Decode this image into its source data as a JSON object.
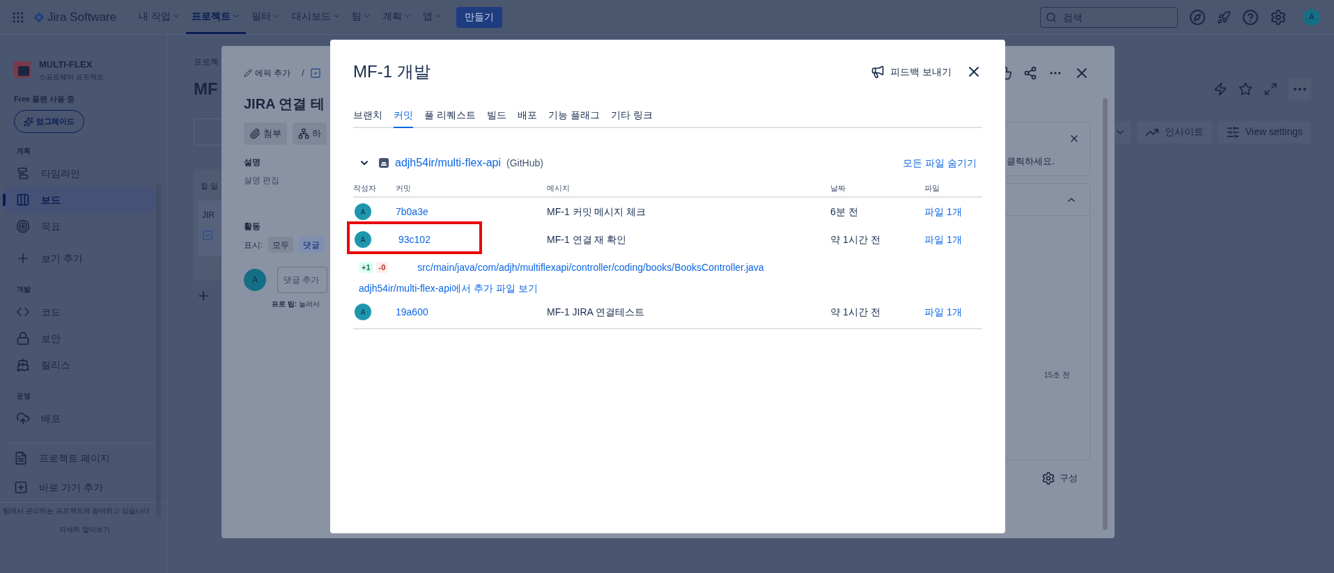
{
  "top_nav": {
    "product": "Jira Software",
    "menus": [
      {
        "label": "내 작업",
        "selected": false
      },
      {
        "label": "프로젝트",
        "selected": true
      },
      {
        "label": "필터",
        "selected": false
      },
      {
        "label": "대시보드",
        "selected": false
      },
      {
        "label": "팀",
        "selected": false
      },
      {
        "label": "계획",
        "selected": false
      },
      {
        "label": "앱",
        "selected": false
      }
    ],
    "create_button": "만들기",
    "search": {
      "placeholder": "검색"
    },
    "avatar": "A"
  },
  "sidebar": {
    "project_name": "MULTI-FLEX",
    "project_type": "소프트웨어 프로젝트",
    "plan": "Free 플랜 사용 중",
    "upgrade_button": "업그레이드",
    "sections": [
      {
        "heading": "계획",
        "items": [
          {
            "label": "타임라인",
            "selected": false
          },
          {
            "label": "보드",
            "selected": true
          },
          {
            "label": "목표",
            "selected": false
          },
          {
            "label": "보기 추가",
            "selected": false
          }
        ]
      },
      {
        "heading": "개발",
        "items": [
          {
            "label": "코드",
            "selected": false
          },
          {
            "label": "보안",
            "selected": false
          },
          {
            "label": "릴리스",
            "selected": false
          }
        ]
      },
      {
        "heading": "운영",
        "items": [
          {
            "label": "배포",
            "selected": false
          }
        ]
      }
    ],
    "links": [
      {
        "label": "프로젝트 페이지"
      },
      {
        "label": "바로 가기 추가"
      }
    ],
    "footer_note": "팀에서 관리하는 프로젝트에 참여하고 있습니다",
    "learn_more": "자세히 알아보기"
  },
  "board": {
    "breadcrumb": "프로젝",
    "title": "MF",
    "column": {
      "title": "할 일",
      "cards": [
        {
          "title": "JIR"
        }
      ]
    },
    "toolbar": [
      {
        "label": "인사이트"
      },
      {
        "label": "View settings"
      }
    ]
  },
  "issue": {
    "epic_link": "에픽 추가",
    "separator": "/",
    "title": "JIRA 연결 테",
    "actions": [
      {
        "label": "첨부"
      },
      {
        "label": "하"
      }
    ],
    "description_heading": "설명",
    "description_placeholder": "설명 편집",
    "activity_heading": "활동",
    "show_label": "표시:",
    "filters": [
      {
        "label": "모두",
        "selected": false
      },
      {
        "label": "댓글",
        "selected": true
      }
    ],
    "avatar": "A",
    "comment": {
      "placeholder": "댓글 추가"
    },
    "pro_tip": "**프로 팁:** 눌러서",
    "notice": "클릭하세요.",
    "panel_time": "15초 전",
    "configure_button": "구성"
  },
  "dialog": {
    "title": "MF-1 개발",
    "feedback_button": "피드백 보내기",
    "tabs": [
      {
        "label": "브랜치",
        "selected": false
      },
      {
        "label": "커밋",
        "selected": true
      },
      {
        "label": "풀 리퀘스트",
        "selected": false
      },
      {
        "label": "빌드",
        "selected": false
      },
      {
        "label": "배포",
        "selected": false
      },
      {
        "label": "기능 플래그",
        "selected": false
      },
      {
        "label": "기타 링크",
        "selected": false
      }
    ],
    "repository": {
      "name": "adjh54ir/multi-flex-api",
      "host": "(GitHub)",
      "expanded": true,
      "toggle_files": "모든 파일 숨기기"
    },
    "columns": [
      "작성자",
      "커밋",
      "메시지",
      "날짜",
      "파일"
    ],
    "commits": [
      {
        "author": "A",
        "hash": "7b0a3e",
        "message": "MF-1 커밋 메시지 체크",
        "date": "6분 전",
        "files": "파일 1개",
        "highlighted": false
      },
      {
        "author": "A",
        "hash": "93c102",
        "message": "MF-1 연결 재 확인",
        "date": "약 1시간 전",
        "files": "파일 1개",
        "highlighted": true,
        "changes": [
          {
            "added": "+1",
            "removed": "-0",
            "path": "src/main/java/com/adjh/multiflexapi/controller/coding/books/BooksController.java"
          }
        ],
        "more_files": "adjh54ir/multi-flex-api에서 추가 파일 보기"
      },
      {
        "author": "A",
        "hash": "19a600",
        "message": "MF-1 JIRA 연결테스트",
        "date": "약 1시간 전",
        "files": "파일 1개",
        "highlighted": false
      }
    ]
  }
}
